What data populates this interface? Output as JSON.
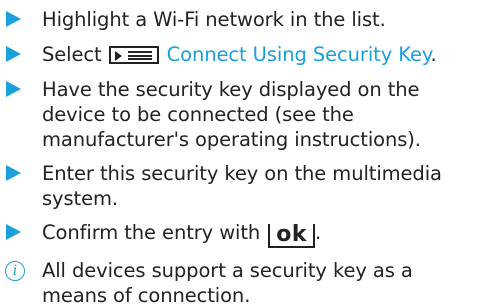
{
  "colors": {
    "accent": "#1aa0da",
    "text": "#222222"
  },
  "icons": {
    "step_marker": "arrow-right-icon",
    "menu_symbol": "menu-list-icon",
    "note_symbol": "info-icon"
  },
  "steps": [
    {
      "text": "Highlight a Wi-Fi network in the list."
    },
    {
      "text_before": "Select ",
      "link_text": "Connect Using Security Key",
      "text_after": "."
    },
    {
      "text": "Have the security key displayed on the device to be connected (see the manufacturer's operating instructions)."
    },
    {
      "text": "Enter this security key on the multimedia sys­tem."
    },
    {
      "text_before": "Confirm the entry with ",
      "key_label": "ok",
      "text_after": "."
    }
  ],
  "note": {
    "icon_glyph": "i",
    "text": "All devices support a security key as a means of connection."
  }
}
